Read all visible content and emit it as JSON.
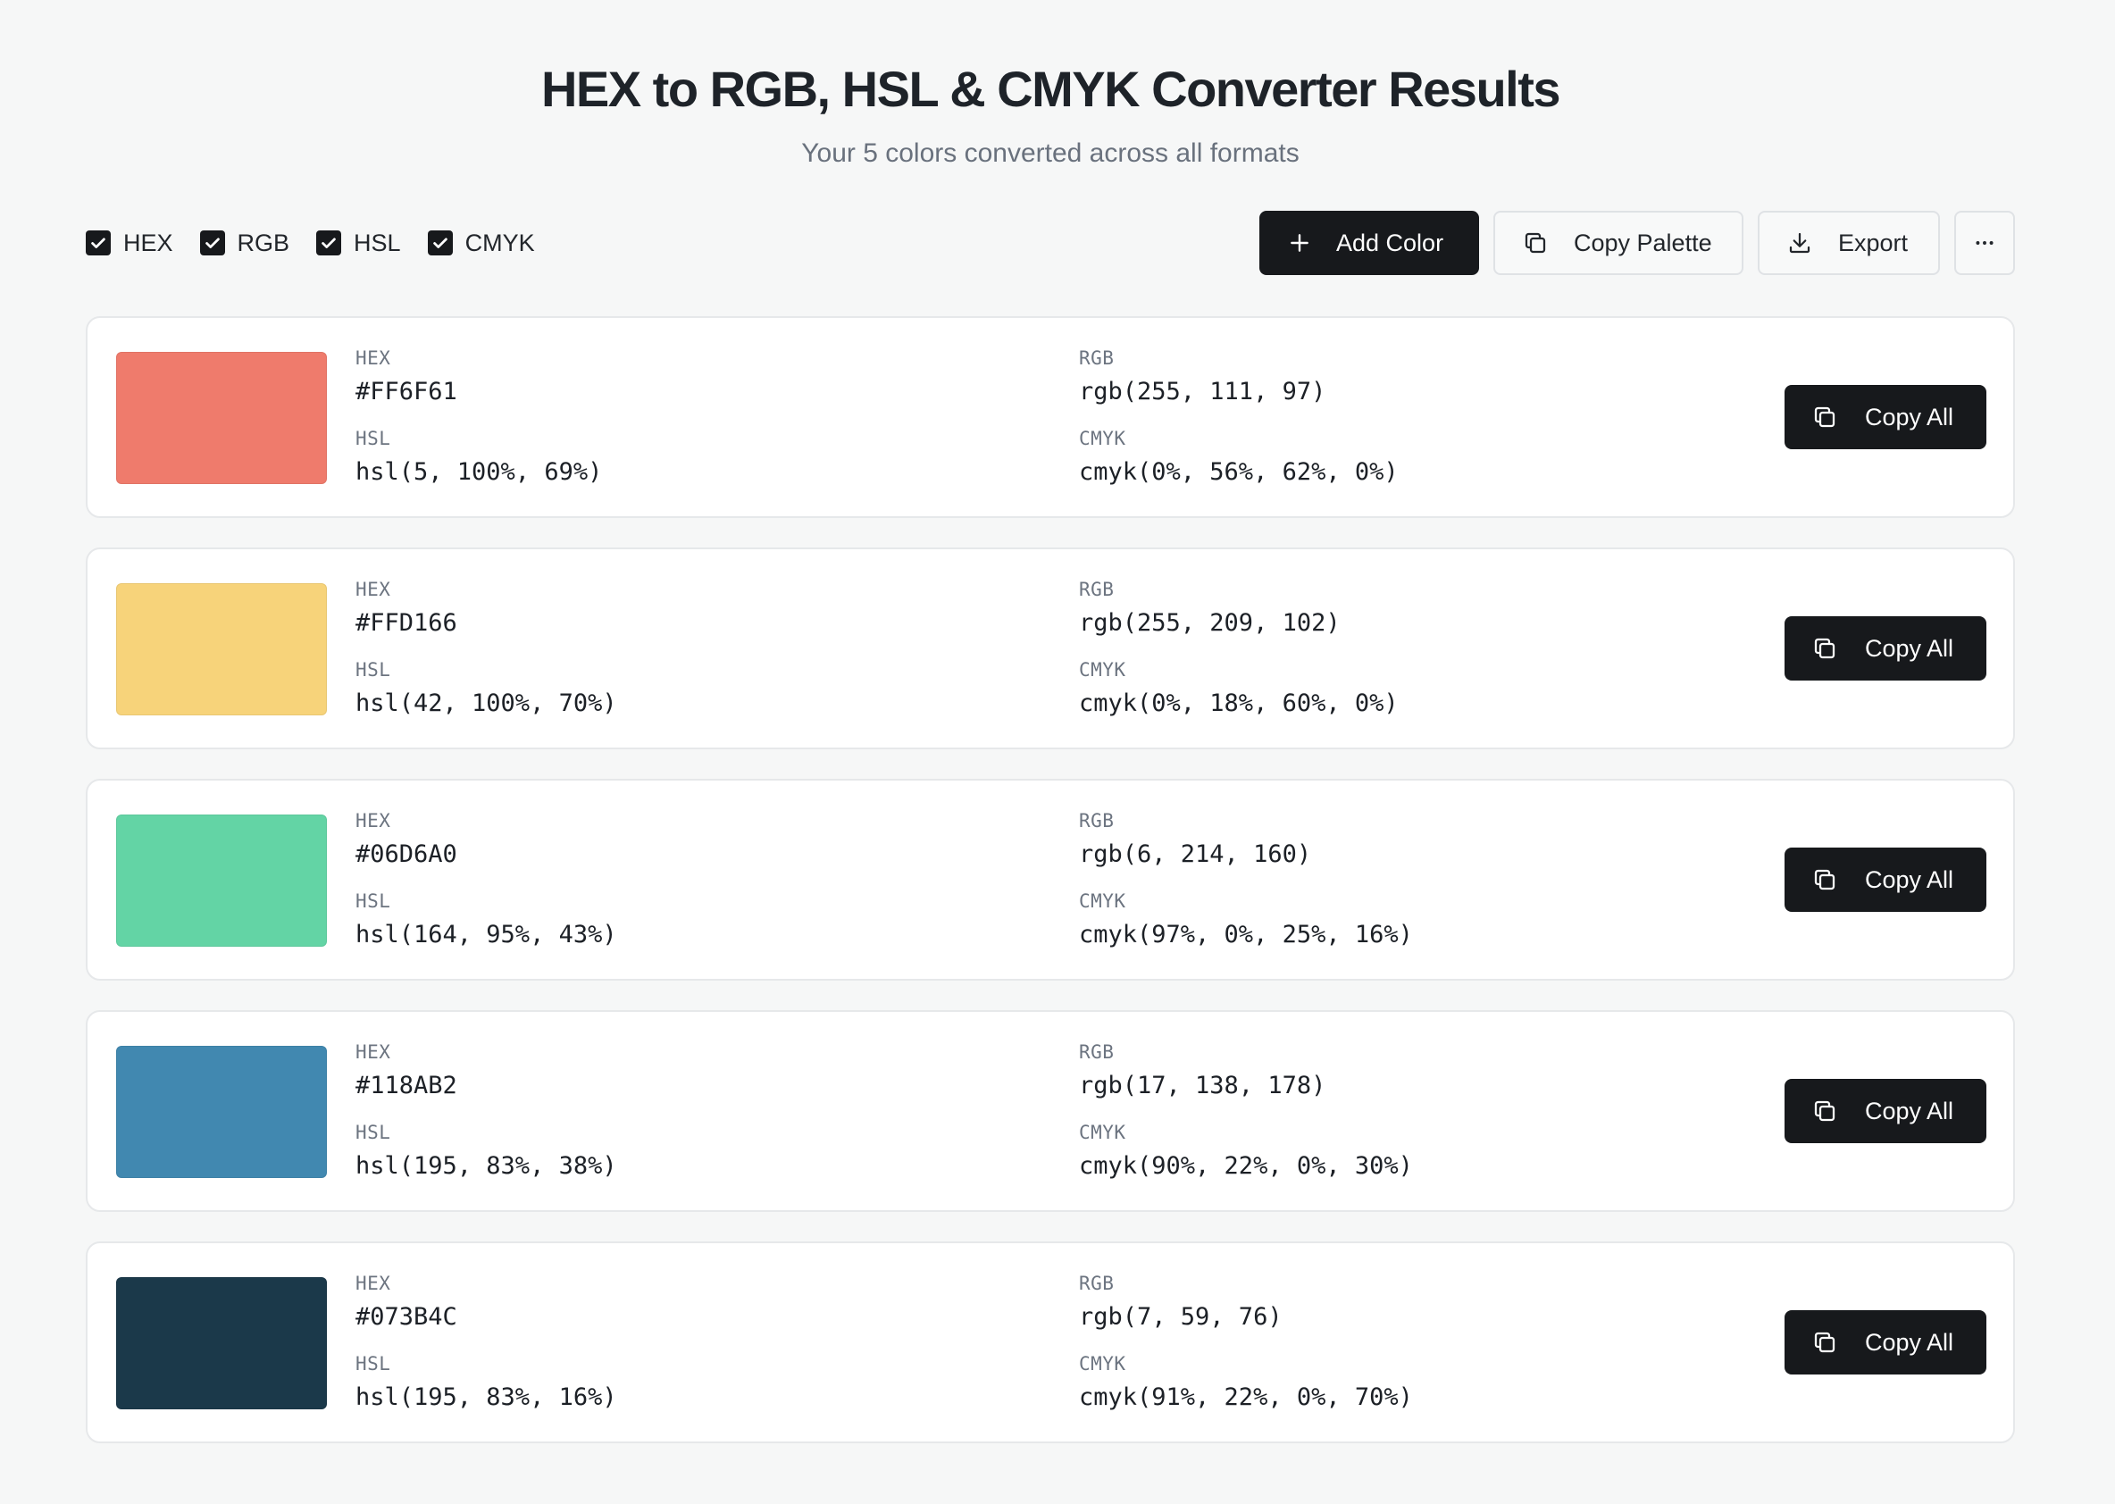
{
  "header": {
    "title": "HEX to RGB, HSL & CMYK Converter Results",
    "subtitle": "Your 5 colors converted across all formats"
  },
  "format_toggles": [
    {
      "label": "HEX",
      "checked": true
    },
    {
      "label": "RGB",
      "checked": true
    },
    {
      "label": "HSL",
      "checked": true
    },
    {
      "label": "CMYK",
      "checked": true
    }
  ],
  "toolbar": {
    "add_color_label": "Add Color",
    "copy_palette_label": "Copy Palette",
    "export_label": "Export",
    "add_icon": "plus-icon",
    "copy_palette_icon": "copy-icon",
    "export_icon": "download-icon",
    "more_icon": "more-horizontal-icon"
  },
  "field_labels": {
    "hex": "HEX",
    "rgb": "RGB",
    "hsl": "HSL",
    "cmyk": "CMYK"
  },
  "colors": [
    {
      "swatch": "#EF7B6C",
      "hex": "#FF6F61",
      "rgb": "rgb(255, 111, 97)",
      "hsl": "hsl(5, 100%, 69%)",
      "cmyk": "cmyk(0%, 56%, 62%, 0%)",
      "copy_label": "Copy All"
    },
    {
      "swatch": "#F7D37A",
      "hex": "#FFD166",
      "rgb": "rgb(255, 209, 102)",
      "hsl": "hsl(42, 100%, 70%)",
      "cmyk": "cmyk(0%, 18%, 60%, 0%)",
      "copy_label": "Copy All"
    },
    {
      "swatch": "#63D4A5",
      "hex": "#06D6A0",
      "rgb": "rgb(6, 214, 160)",
      "hsl": "hsl(164, 95%, 43%)",
      "cmyk": "cmyk(97%, 0%, 25%, 16%)",
      "copy_label": "Copy All"
    },
    {
      "swatch": "#4188B0",
      "hex": "#118AB2",
      "rgb": "rgb(17, 138, 178)",
      "hsl": "hsl(195, 83%, 38%)",
      "cmyk": "cmyk(90%, 22%, 0%, 30%)",
      "copy_label": "Copy All"
    },
    {
      "swatch": "#1B394A",
      "hex": "#073B4C",
      "rgb": "rgb(7, 59, 76)",
      "hsl": "hsl(195, 83%, 16%)",
      "cmyk": "cmyk(91%, 22%, 0%, 70%)",
      "copy_label": "Copy All"
    }
  ],
  "theme": {
    "primary": "#17191C",
    "background": "#F6F7F7",
    "card": "#FFFFFF",
    "border": "#E6E8EA",
    "muted_text": "#69717D"
  }
}
